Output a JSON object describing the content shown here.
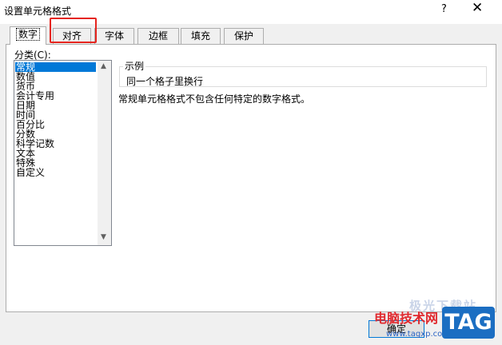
{
  "window": {
    "title": "设置单元格格式",
    "help": "?",
    "close": "✕"
  },
  "tabs": [
    {
      "label": "数字",
      "active": true
    },
    {
      "label": "对齐",
      "active": false
    },
    {
      "label": "字体",
      "active": false
    },
    {
      "label": "边框",
      "active": false
    },
    {
      "label": "填充",
      "active": false
    },
    {
      "label": "保护",
      "active": false
    }
  ],
  "category": {
    "label": "分类(C):",
    "items": [
      "常规",
      "数值",
      "货币",
      "会计专用",
      "日期",
      "时间",
      "百分比",
      "分数",
      "科学记数",
      "文本",
      "特殊",
      "自定义"
    ],
    "selected_index": 0
  },
  "sample": {
    "legend": "示例",
    "text": "同一个格子里换行"
  },
  "description": "常规单元格格式不包含任何特定的数字格式。",
  "buttons": {
    "ok": "确定"
  },
  "watermark": {
    "site_name": "电脑技术网",
    "url": "www.tagxp.com",
    "faint": "极光下载站",
    "tag": "TAG"
  },
  "colors": {
    "accent": "#0078d7",
    "highlight_box": "#e5251f",
    "dialog_bg": "#f0f0f0"
  }
}
